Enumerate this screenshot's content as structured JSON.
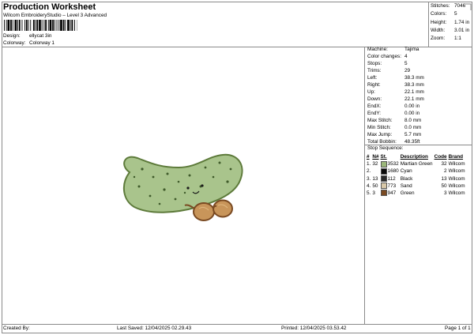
{
  "header": {
    "title": "Production Worksheet",
    "subtitle": "Wilcom EmbroideryStudio – Level 3 Advanced"
  },
  "meta": {
    "design_label": "Design:",
    "design_value": "ellycat 3in",
    "colorway_label": "Colorway:",
    "colorway_value": "Colorway 1"
  },
  "stats": [
    {
      "label": "Stitches:",
      "value": "7046"
    },
    {
      "label": "Colors:",
      "value": "5"
    },
    {
      "label": "Height:",
      "value": "1.74 in"
    },
    {
      "label": "Width:",
      "value": "3.01 in"
    },
    {
      "label": "Zoom:",
      "value": "1:1"
    }
  ],
  "machine": [
    {
      "label": "Machine:",
      "value": "Tajima"
    },
    {
      "label": "Color changes:",
      "value": "4"
    },
    {
      "label": "Stops:",
      "value": "5"
    },
    {
      "label": "Trims:",
      "value": "29"
    },
    {
      "label": "Left:",
      "value": "38.3 mm"
    },
    {
      "label": "Right:",
      "value": "38.3 mm"
    },
    {
      "label": "Up:",
      "value": "22.1 mm"
    },
    {
      "label": "Down:",
      "value": "22.1 mm"
    },
    {
      "label": "EndX:",
      "value": "0.00 in"
    },
    {
      "label": "EndY:",
      "value": "0.00 in"
    },
    {
      "label": "Max Stitch:",
      "value": "8.0 mm"
    },
    {
      "label": "Min Stitch:",
      "value": "0.0 mm"
    },
    {
      "label": "Max Jump:",
      "value": "5.7 mm"
    },
    {
      "label": "Total Bobbin:",
      "value": "48.35ft"
    }
  ],
  "stop_sequence": {
    "title": "Stop Sequence:",
    "headers": {
      "num": "#",
      "n": "N#",
      "st": "St.",
      "desc": "Description",
      "code": "Code",
      "brand": "Brand"
    },
    "rows": [
      {
        "num": "1.",
        "n": "32",
        "color": "#9bb77a",
        "st": "3532",
        "desc": "Martian Green",
        "code": "32",
        "brand": "Wilcom"
      },
      {
        "num": "2.",
        "n": "",
        "color": "#0a0a0a",
        "st": "1680",
        "desc": "Cyan",
        "code": "2",
        "brand": "Wilcom"
      },
      {
        "num": "3.",
        "n": "13",
        "color": "#2a2a2a",
        "st": "112",
        "desc": "Black",
        "code": "13",
        "brand": "Wilcom"
      },
      {
        "num": "4.",
        "n": "50",
        "color": "#d8c8a8",
        "st": "773",
        "desc": "Sand",
        "code": "50",
        "brand": "Wilcom"
      },
      {
        "num": "5.",
        "n": "3",
        "color": "#7a4a22",
        "st": "947",
        "desc": "Green",
        "code": "3",
        "brand": "Wilcom"
      }
    ]
  },
  "footer": {
    "created_by": "Created By:",
    "last_saved": "Last Saved: 12/04/2025 02.29.43",
    "printed": "Printed: 12/04/2025 03.53.42",
    "page": "Page 1 of 1"
  },
  "colors": {
    "pickle_fill": "#a9c48c",
    "pickle_edge": "#5d7a3a",
    "glasses": "#c8955a",
    "border": "#8a8a8a"
  }
}
